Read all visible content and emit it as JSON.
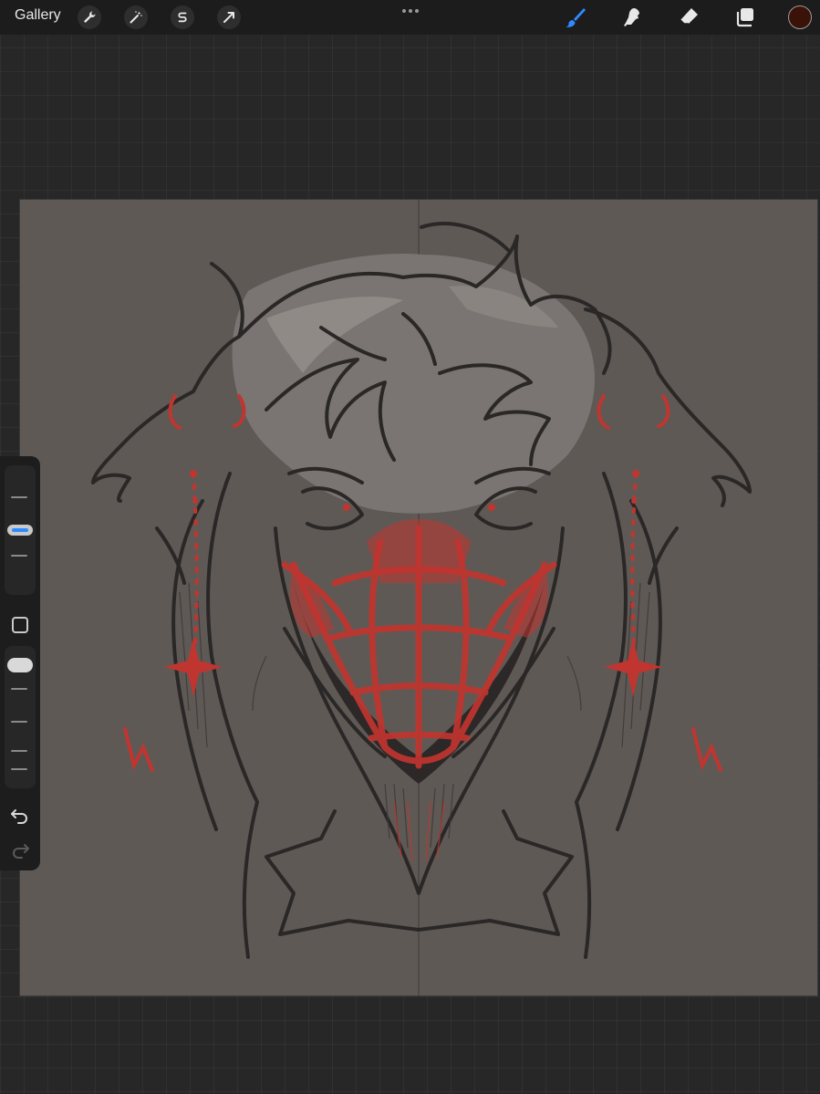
{
  "topbar": {
    "gallery_label": "Gallery",
    "left_tools": [
      "wrench-icon",
      "magic-wand-icon",
      "selection-s-icon",
      "transform-arrow-icon"
    ],
    "right_tools": [
      "brush-icon",
      "smudge-icon",
      "eraser-icon",
      "layers-icon"
    ],
    "active_tool": "brush",
    "active_color": "#3a1208",
    "accent": "#2e8bff"
  },
  "sidebar": {
    "brush_size_level": 0.55,
    "opacity_level": 0.1
  },
  "canvas": {
    "background": "#5f5955",
    "symmetry_guide": "vertical"
  }
}
